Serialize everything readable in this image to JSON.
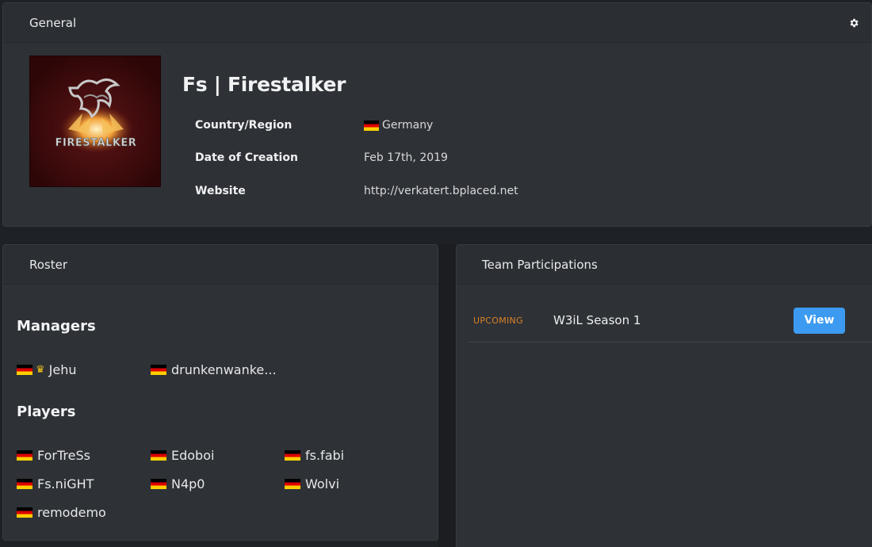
{
  "general": {
    "header": "General",
    "logo_text": "FIRESTALKER",
    "team_name": "Fs | Firestalker",
    "info": [
      {
        "label": "Country/Region",
        "value": "Germany",
        "flag": "de"
      },
      {
        "label": "Date of Creation",
        "value": "Feb 17th, 2019"
      },
      {
        "label": "Website",
        "value": "http://verkatert.bplaced.net"
      }
    ],
    "settings_icon": "gear-icon"
  },
  "roster": {
    "header": "Roster",
    "managers_title": "Managers",
    "managers": [
      {
        "name": "Jehu",
        "flag": "de",
        "crown": true
      },
      {
        "name": "drunkenwanke...",
        "flag": "de"
      }
    ],
    "players_title": "Players",
    "players": [
      {
        "name": "ForTreSs",
        "flag": "de"
      },
      {
        "name": "Edoboi",
        "flag": "de"
      },
      {
        "name": "fs.fabi",
        "flag": "de"
      },
      {
        "name": "Fs.niGHT",
        "flag": "de"
      },
      {
        "name": "N4p0",
        "flag": "de"
      },
      {
        "name": "Wolvi",
        "flag": "de"
      },
      {
        "name": "remodemo",
        "flag": "de"
      }
    ]
  },
  "participations": {
    "header": "Team Participations",
    "items": [
      {
        "status": "UPCOMING",
        "name": "W3iL Season 1",
        "action": "View"
      }
    ]
  },
  "colors": {
    "background": "#1e2125",
    "panel": "#2e3136",
    "accent_button": "#3c9bf0",
    "status_upcoming": "#d9822b",
    "crown": "#f0c419"
  }
}
